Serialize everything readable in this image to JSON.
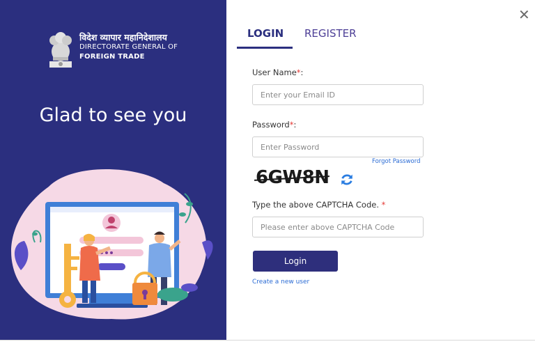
{
  "branding": {
    "org_hindi": "विदेश व्यापार महानिदेशालय",
    "org_line2": "DIRECTORATE GENERAL OF",
    "org_line3": "FOREIGN TRADE",
    "welcome": "Glad to see you"
  },
  "tabs": [
    {
      "label": "LOGIN",
      "active": true
    },
    {
      "label": "REGISTER",
      "active": false
    }
  ],
  "form": {
    "username_label": "User Name",
    "username_placeholder": "Enter your Email ID",
    "password_label": "Password",
    "password_placeholder": "Enter Password",
    "required_mark": "*",
    "label_suffix": ":",
    "forgot_password": "Forgot Password",
    "captcha_text": "6GW8N",
    "captcha_label": "Type the above CAPTCHA Code.",
    "captcha_placeholder": "Please enter above CAPTCHA Code",
    "login_button": "Login",
    "create_user": "Create a new user"
  },
  "icons": {
    "close": "close-icon",
    "refresh": "refresh-icon",
    "emblem": "national-emblem-icon"
  },
  "colors": {
    "panel": "#2b2f7f",
    "button": "#2e2f7c",
    "link": "#2a6bd4",
    "required": "#e53935"
  }
}
